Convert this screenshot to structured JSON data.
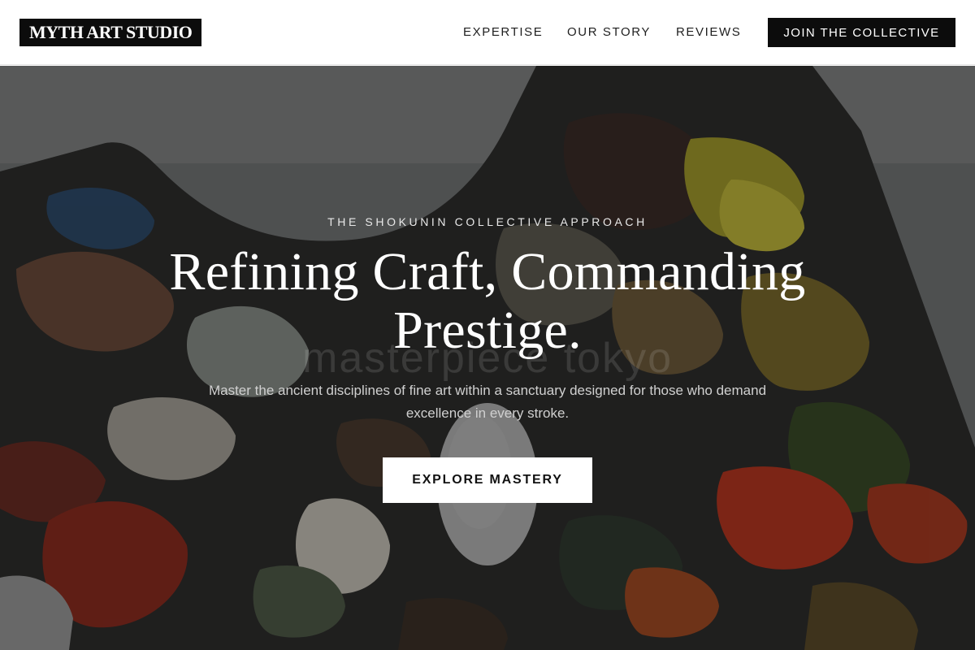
{
  "header": {
    "logo": "MYTH ART STUDIO",
    "nav": [
      {
        "label": "EXPERTISE"
      },
      {
        "label": "OUR STORY"
      },
      {
        "label": "REVIEWS"
      }
    ],
    "cta_label": "JOIN THE COLLECTIVE"
  },
  "hero": {
    "eyebrow": "THE SHOKUNIN COLLECTIVE APPROACH",
    "title_line1": "Refining Craft, Commanding",
    "title_line2": "Prestige.",
    "watermark": "masterpiece tokyo",
    "subtitle": "Master the ancient disciplines of fine art within a sanctuary designed for those who demand excellence in every stroke.",
    "cta_label": "EXPLORE MASTERY",
    "image_description_icon": "paint-palette-background"
  },
  "colors": {
    "header_bg": "#ffffff",
    "primary_dark": "#0c0c0c",
    "hero_overlay": "#3e4142",
    "text_light": "#ffffff"
  }
}
